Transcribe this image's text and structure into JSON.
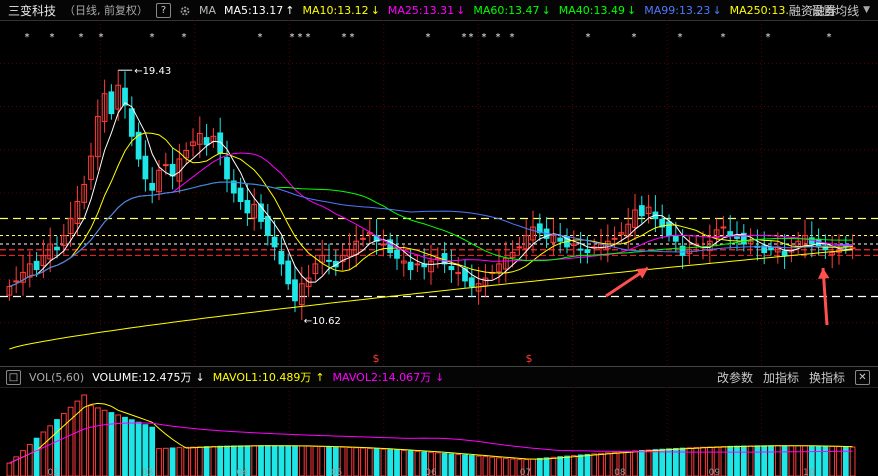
{
  "header": {
    "stock_name": "三变科技",
    "mode": "（日线, 前复权）",
    "help_label": "?",
    "ma_label": "MA",
    "ma5": "MA5:13.17",
    "ma10": "MA10:13.12",
    "ma25": "MA25:13.31",
    "ma60": "MA60:13.47",
    "ma40": "MA40:13.49",
    "ma99": "MA99:13.23",
    "ma250": "MA250:13.",
    "rzrq": "融资融券",
    "settings": "设置均线",
    "arrow_up": "↑",
    "arrow_down": "↓"
  },
  "volume_header": {
    "close_label": "□",
    "title": "VOL(5,60)",
    "volume": "VOLUME:12.475万",
    "mavol1": "MAVOL1:10.489万",
    "mavol2": "MAVOL2:14.067万",
    "arrow_down": "↓",
    "arrow_up": "↑",
    "params_button": "改参数",
    "add_indicator_button": "加指标",
    "switch_indicator_button": "换指标",
    "close_button": "✕"
  },
  "annotations": {
    "high_label": "19.43",
    "low_label": "10.62",
    "dollar_mark": "$"
  },
  "colors": {
    "ma5": "#ffffff",
    "ma10": "#ffff00",
    "ma25": "#ff00ff",
    "ma60": "#00ff00",
    "ma40": "#00ff00",
    "ma99": "#5078ff",
    "ma250": "#ffff00",
    "up": "#ff3b3b",
    "down": "#1ee6e6",
    "arrow": "#ff5050"
  },
  "chart_data": {
    "type": "candlestick",
    "price_range": [
      9.0,
      21.2
    ],
    "high": 19.43,
    "low": 10.62,
    "reference_lines": [
      14.2,
      13.6,
      13.3,
      13.1,
      12.9,
      11.45
    ],
    "x_tick_labels": [
      "02",
      "03",
      "04",
      "05",
      "06",
      "07",
      "08",
      "09",
      "10"
    ],
    "closes": [
      11.8,
      12.0,
      12.3,
      12.6,
      12.4,
      12.9,
      13.3,
      13.1,
      13.6,
      14.2,
      14.8,
      15.4,
      16.4,
      17.8,
      18.6,
      17.9,
      18.9,
      18.2,
      17.1,
      16.3,
      15.6,
      15.2,
      15.9,
      16.1,
      15.7,
      16.3,
      16.6,
      16.9,
      17.2,
      16.8,
      17.1,
      16.5,
      15.6,
      15.1,
      14.8,
      14.4,
      14.7,
      14.1,
      13.6,
      13.2,
      12.6,
      11.9,
      11.3,
      11.9,
      12.1,
      12.6,
      12.9,
      12.7,
      12.5,
      12.9,
      13.1,
      13.4,
      13.5,
      13.7,
      13.4,
      13.3,
      13.0,
      12.8,
      12.7,
      12.4,
      12.6,
      12.5,
      12.7,
      12.8,
      12.6,
      12.4,
      12.3,
      12.0,
      11.8,
      11.9,
      12.1,
      12.3,
      12.6,
      12.8,
      13.0,
      13.2,
      13.6,
      13.9,
      13.7,
      13.5,
      13.6,
      13.4,
      13.2,
      13.3,
      13.1,
      13.0,
      13.2,
      13.3,
      13.4,
      13.5,
      13.7,
      14.0,
      14.5,
      14.3,
      14.6,
      14.2,
      13.9,
      13.6,
      13.4,
      12.9,
      13.1,
      13.3,
      13.2,
      13.4,
      13.8,
      13.9,
      13.6,
      13.5,
      13.3,
      13.4,
      13.2,
      13.0,
      13.1,
      13.2,
      12.9,
      13.1,
      13.4,
      13.6,
      13.3,
      13.2,
      13.1,
      13.0,
      13.1,
      13.2,
      13.17
    ]
  }
}
